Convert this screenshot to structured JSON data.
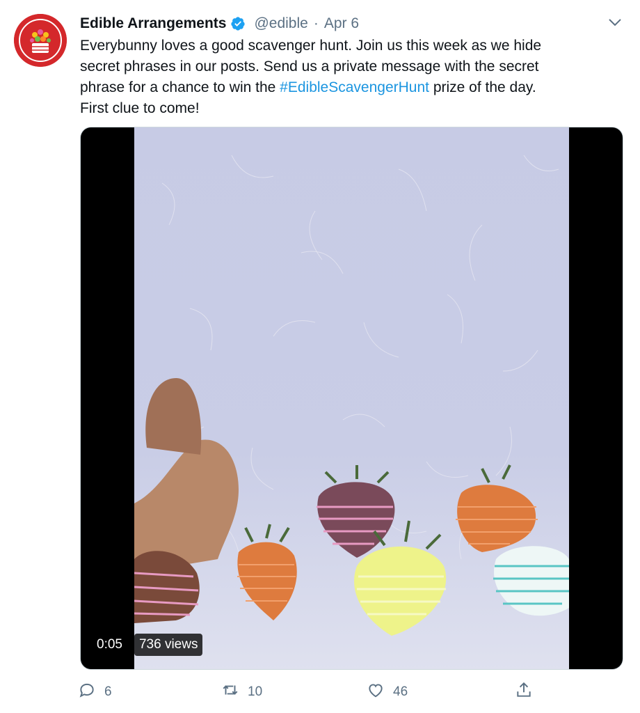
{
  "tweet": {
    "author_name": "Edible Arrangements",
    "handle": "@edible",
    "separator": "·",
    "date": "Apr 6",
    "text_lines": [
      "Everybunny loves a good scavenger hunt. Join us this week as we hide",
      "secret phrases in our posts. Send us a private message with the secret"
    ],
    "text_line3_before": "phrase for a chance to win the ",
    "hashtag": "#EdibleScavengerHunt",
    "text_line3_after": " prize of the day.",
    "text_line4": "First clue to come!"
  },
  "media": {
    "time": "0:05",
    "views": "736 views"
  },
  "actions": {
    "reply_count": "6",
    "retweet_count": "10",
    "like_count": "46"
  },
  "icons": [
    "verified-badge-icon",
    "chevron-down-icon",
    "reply-icon",
    "retweet-icon",
    "like-icon",
    "share-icon"
  ],
  "colors": {
    "accent": "#1b95e0",
    "secondary_text": "#5b7083",
    "brand_red": "#d4282b"
  }
}
